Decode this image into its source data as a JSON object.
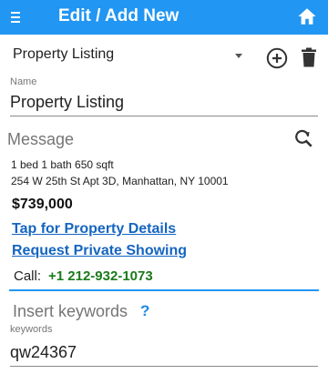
{
  "appbar": {
    "title": "Edit / Add New",
    "menu_icon": "hamburger-menu-icon",
    "home_icon": "home-icon",
    "background": "#2196f3"
  },
  "template_select": {
    "selected": "Property Listing",
    "add_icon": "add-circle-icon",
    "delete_icon": "trash-icon"
  },
  "name_field": {
    "label": "Name",
    "value": "Property Listing"
  },
  "message": {
    "label": "Message",
    "action_icon": "refresh-search-icon",
    "line1": "1 bed 1 bath 650 sqft",
    "line2": "254 W 25th St Apt 3D, Manhattan, NY 10001",
    "price": "$739,000",
    "link_details": "Tap for Property Details",
    "link_showing": "Request Private Showing",
    "call_label": "Call:",
    "call_number": "+1 212-932-1073",
    "accent": "#2196f3",
    "link_color": "#1565c0",
    "phone_color": "#1b7a1b"
  },
  "keywords": {
    "label": "Insert keywords",
    "help": "?",
    "sublabel": "keywords",
    "value": "qw24367"
  }
}
